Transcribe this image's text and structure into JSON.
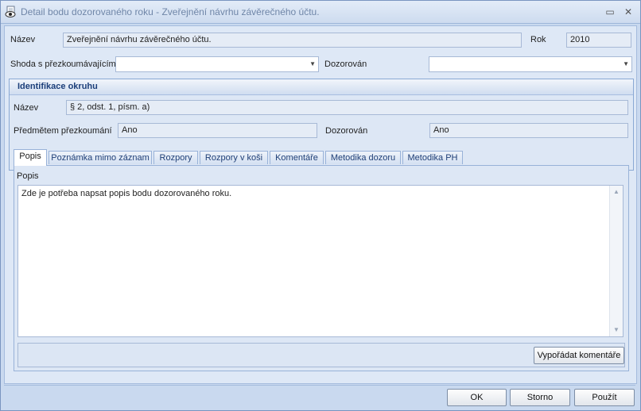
{
  "window": {
    "title": "Detail bodu dozorovaného roku - Zveřejnění návrhu závěrečného účtu.",
    "title_icon": "eye-document-icon",
    "maximize_glyph": "▭",
    "close_glyph": "✕"
  },
  "form": {
    "nazev_label": "Název",
    "nazev_value": "Zveřejnění návrhu závěrečného účtu.",
    "rok_label": "Rok",
    "rok_value": "2010",
    "shoda_label": "Shoda s přezkoumávajícím",
    "shoda_value": "",
    "dozorovan_label": "Dozorován",
    "dozorovan_value": ""
  },
  "identifikace": {
    "header": "Identifikace okruhu",
    "nazev_label": "Název",
    "nazev_value": "§ 2, odst. 1, písm. a)",
    "predmetem_label": "Předmětem přezkoumání",
    "predmetem_value": "Ano",
    "dozorovan_label": "Dozorován",
    "dozorovan_value": "Ano"
  },
  "tabs": [
    {
      "label": "Popis"
    },
    {
      "label": "Poznámka mimo záznam"
    },
    {
      "label": "Rozpory"
    },
    {
      "label": "Rozpory v koši"
    },
    {
      "label": "Komentáře"
    },
    {
      "label": "Metodika dozoru"
    },
    {
      "label": "Metodika PH"
    }
  ],
  "active_tab": "Popis",
  "popis": {
    "label": "Popis",
    "text": "Zde je potřeba napsat popis bodu dozorovaného roku.",
    "comments_button": "Vypořádat komentáře"
  },
  "footer": {
    "ok": "OK",
    "storno": "Storno",
    "pouzit": "Použít"
  },
  "colors": {
    "accent": "#1c3f7a",
    "window_bg": "#dee8f6",
    "field_border": "#a7b9d6"
  }
}
